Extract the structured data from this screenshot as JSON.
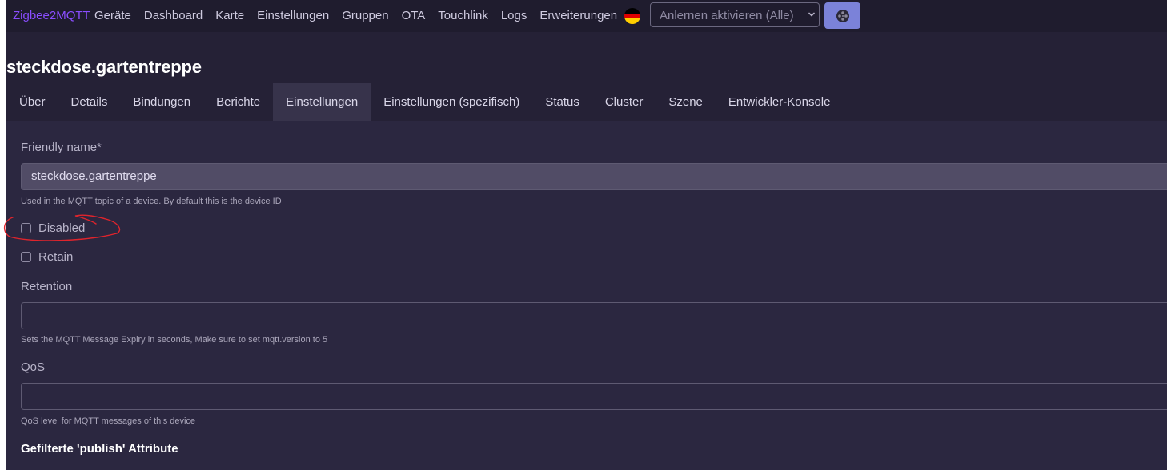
{
  "navbar": {
    "brand": "Zigbee2MQTT",
    "links": [
      {
        "label": "Geräte"
      },
      {
        "label": "Dashboard"
      },
      {
        "label": "Karte"
      },
      {
        "label": "Einstellungen"
      },
      {
        "label": "Gruppen"
      },
      {
        "label": "OTA"
      },
      {
        "label": "Touchlink"
      },
      {
        "label": "Logs"
      },
      {
        "label": "Erweiterungen"
      }
    ],
    "language_flag_icon": "germany-flag-icon",
    "permit_join": {
      "label": "Anlernen aktivieren (Alle)",
      "caret_icon": "chevron-down-icon"
    },
    "extra_button_icon": "film-reel-icon"
  },
  "page": {
    "title": "steckdose.gartentreppe"
  },
  "tabs": [
    {
      "label": "Über"
    },
    {
      "label": "Details"
    },
    {
      "label": "Bindungen"
    },
    {
      "label": "Berichte"
    },
    {
      "label": "Einstellungen",
      "active": true
    },
    {
      "label": "Einstellungen (spezifisch)"
    },
    {
      "label": "Status"
    },
    {
      "label": "Cluster"
    },
    {
      "label": "Szene"
    },
    {
      "label": "Entwickler-Konsole"
    }
  ],
  "form": {
    "friendly_name": {
      "label": "Friendly name*",
      "value": "steckdose.gartentreppe",
      "help": "Used in the MQTT topic of a device. By default this is the device ID"
    },
    "disabled": {
      "label": "Disabled",
      "checked": false
    },
    "retain": {
      "label": "Retain",
      "checked": false
    },
    "retention": {
      "label": "Retention",
      "value": "",
      "help": "Sets the MQTT Message Expiry in seconds, Make sure to set mqtt.version to 5"
    },
    "qos": {
      "label": "QoS",
      "value": "",
      "help": "QoS level for MQTT messages of this device"
    },
    "filtered_publish": {
      "heading": "Gefilterte 'publish' Attribute"
    }
  },
  "colors": {
    "brand": "#8a4dff",
    "annotation": "#e0242c",
    "button_accent": "#7b82d9"
  }
}
